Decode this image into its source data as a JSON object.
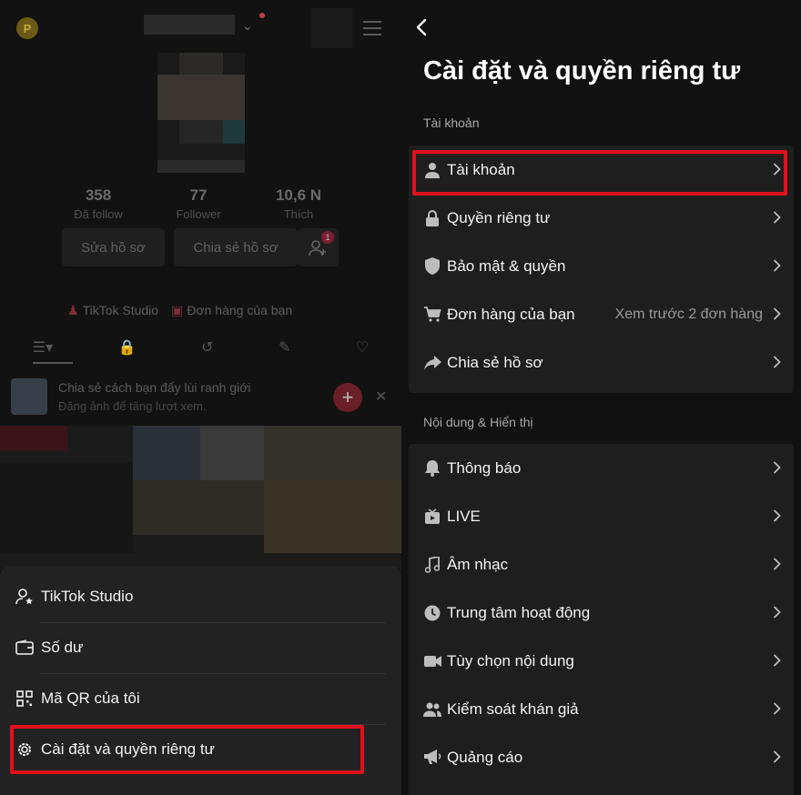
{
  "profile": {
    "coin_letter": "P",
    "stats": [
      {
        "value": "358",
        "label": "Đã follow"
      },
      {
        "value": "77",
        "label": "Follower"
      },
      {
        "value": "10,6 N",
        "label": "Thích"
      }
    ],
    "edit_profile_label": "Sửa hồ sơ",
    "share_profile_label": "Chia sẻ hồ sơ",
    "add_friend_badge": "1",
    "links": {
      "studio": "TikTok Studio",
      "orders": "Đơn hàng của bạn"
    },
    "promo": {
      "title": "Chia sẻ cách bạn đẩy lùi ranh giới",
      "subtitle": "Đăng ảnh để tăng lượt xem."
    }
  },
  "sheet": {
    "items": [
      {
        "label": "TikTok Studio",
        "icon": "person-star-icon"
      },
      {
        "label": "Số dư",
        "icon": "wallet-icon"
      },
      {
        "label": "Mã QR của tôi",
        "icon": "qr-code-icon"
      },
      {
        "label": "Cài đặt và quyền riêng tư",
        "icon": "gear-icon"
      }
    ]
  },
  "settings": {
    "title": "Cài đặt và quyền riêng tư",
    "sections": [
      {
        "header": "Tài khoản",
        "items": [
          {
            "label": "Tài khoản",
            "icon": "person-icon",
            "value": ""
          },
          {
            "label": "Quyền riêng tư",
            "icon": "lock-icon",
            "value": ""
          },
          {
            "label": "Bảo mật & quyền",
            "icon": "shield-icon",
            "value": ""
          },
          {
            "label": "Đơn hàng của bạn",
            "icon": "cart-icon",
            "value": "Xem trước 2 đơn hàng"
          },
          {
            "label": "Chia sẻ hồ sơ",
            "icon": "share-arrow-icon",
            "value": ""
          }
        ]
      },
      {
        "header": "Nội dung & Hiển thị",
        "items": [
          {
            "label": "Thông báo",
            "icon": "bell-icon",
            "value": ""
          },
          {
            "label": "LIVE",
            "icon": "live-tv-icon",
            "value": ""
          },
          {
            "label": "Âm nhạc",
            "icon": "music-note-icon",
            "value": ""
          },
          {
            "label": "Trung tâm hoạt động",
            "icon": "clock-icon",
            "value": ""
          },
          {
            "label": "Tùy chọn nội dung",
            "icon": "video-camera-icon",
            "value": ""
          },
          {
            "label": "Kiểm soát khán giả",
            "icon": "people-icon",
            "value": ""
          },
          {
            "label": "Quảng cáo",
            "icon": "megaphone-icon",
            "value": ""
          }
        ]
      }
    ]
  },
  "colors": {
    "highlight": "#e0101c",
    "background": "#111111",
    "card": "#1e1e1e"
  }
}
